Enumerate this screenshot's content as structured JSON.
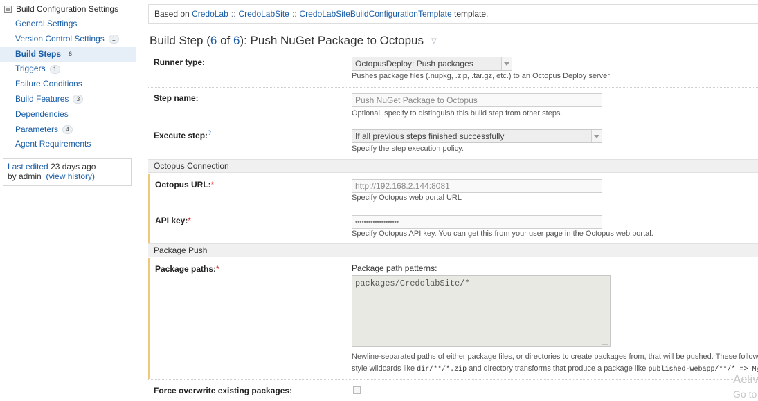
{
  "sidebar": {
    "header": "Build Configuration Settings",
    "items": [
      {
        "label": "General Settings",
        "count": ""
      },
      {
        "label": "Version Control Settings",
        "count": "1"
      },
      {
        "label": "Build Steps",
        "count": "6"
      },
      {
        "label": "Triggers",
        "count": "1"
      },
      {
        "label": "Failure Conditions",
        "count": ""
      },
      {
        "label": "Build Features",
        "count": "3"
      },
      {
        "label": "Dependencies",
        "count": ""
      },
      {
        "label": "Parameters",
        "count": "4"
      },
      {
        "label": "Agent Requirements",
        "count": ""
      }
    ],
    "info": {
      "line1_prefix": "Last edited",
      "line1_value": "23 days ago",
      "line2_prefix": "by admin",
      "history_link": "(view history)"
    }
  },
  "template_bar": {
    "prefix": "Based on",
    "path": [
      "CredoLab",
      "CredoLabSite",
      "CredoLabSiteBuildConfigurationTemplate"
    ],
    "separator": "::",
    "suffix": "template."
  },
  "title": {
    "prefix": "Build Step (",
    "current": "6",
    "mid": " of ",
    "total": "6",
    "suffix": "): Push NuGet Package to Octopus"
  },
  "form": {
    "runner": {
      "label": "Runner type:",
      "value": "OctopusDeploy: Push packages",
      "note": "Pushes package files (.nupkg, .zip, .tar.gz, etc.) to an Octopus Deploy server"
    },
    "step_name": {
      "label": "Step name:",
      "value": "Push NuGet Package to Octopus",
      "note": "Optional, specify to distinguish this build step from other steps."
    },
    "execute": {
      "label": "Execute step:",
      "help": "?",
      "value": "If all previous steps finished successfully",
      "note": "Specify the step execution policy."
    },
    "section_connection": "Octopus Connection",
    "octopus_url": {
      "label": "Octopus URL:",
      "req": "*",
      "value": "http://192.168.2.144:8081",
      "note": "Specify Octopus web portal URL"
    },
    "api_key": {
      "label": "API key:",
      "req": "*",
      "value": "••••••••••••••••••••",
      "note": "Specify Octopus API key. You can get this from your user page in the Octopus web portal."
    },
    "section_push": "Package Push",
    "package_paths": {
      "label": "Package paths:",
      "req": "*",
      "sublabel": "Package path patterns:",
      "value": "packages/CredolabSite/*",
      "note1": "Newline-separated paths of either package files, or directories to create packages from, that will be pushed. These follow the",
      "note2_prefix": "style wildcards like",
      "note2_code1": "dir/**/*.zip",
      "note2_mid": "and directory transforms that produce a package like",
      "note2_code2": "published-webapp/**/* => MyAp"
    },
    "force_overwrite": {
      "label": "Force overwrite existing packages:",
      "checked": false
    }
  },
  "watermark": {
    "line1": "Activ",
    "line2": "Go to"
  }
}
